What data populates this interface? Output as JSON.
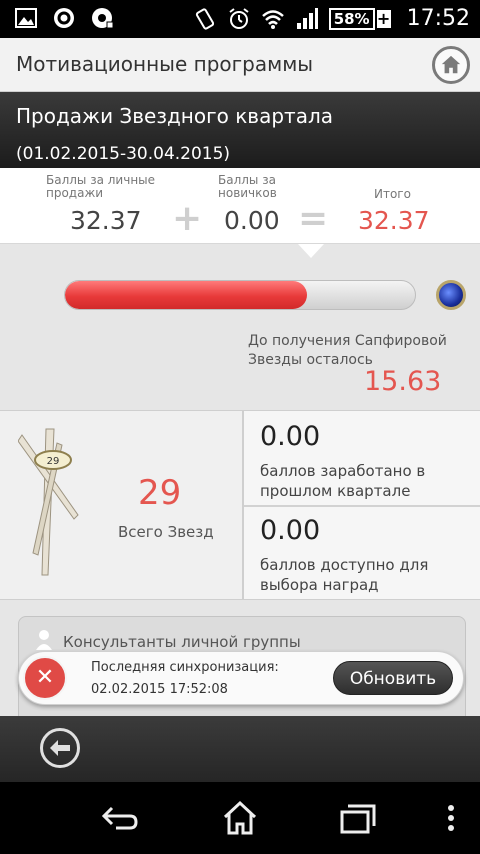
{
  "status_bar": {
    "battery_percent": "58%",
    "time": "17:52",
    "icons": [
      "image-icon",
      "app-circle-icon",
      "media-icon",
      "vibrate-icon",
      "alarm-icon",
      "wifi-icon",
      "signal-icon",
      "battery-icon"
    ]
  },
  "app_bar": {
    "title": "Мотивационные программы",
    "home_icon": "home-icon"
  },
  "program": {
    "title": "Продажи Звездного квартала",
    "dates": "(01.02.2015-30.04.2015)"
  },
  "points": {
    "personal_label_1": "Баллы за личные",
    "personal_label_2": "продажи",
    "personal_value": "32.37",
    "plus": "+",
    "newbie_label_1": "Баллы за",
    "newbie_label_2": "новичков",
    "newbie_value": "0.00",
    "equals": "=",
    "total_label": "Итого",
    "total_value": "32.37"
  },
  "progress": {
    "fraction": 0.69,
    "target_icon": "sapphire-star-icon",
    "remaining_label": "До получения Сапфировой Звезды осталось",
    "remaining_value": "15.63"
  },
  "stars": {
    "badge_number": "29",
    "total_value": "29",
    "total_label": "Всего Звезд",
    "last_quarter_value": "0.00",
    "last_quarter_label": "баллов заработано в прошлом квартале",
    "available_value": "0.00",
    "available_label": "баллов доступно для выбора наград"
  },
  "consultants": {
    "title": "Консультанты личной группы"
  },
  "sync": {
    "label": "Последняя синхронизация:",
    "datetime": "02.02.2015 17:52:08",
    "refresh_label": "Обновить"
  },
  "colors": {
    "accent_red": "#e4564f",
    "progress_red": "#e83a3a",
    "header_dark": "#2a2a2a"
  }
}
